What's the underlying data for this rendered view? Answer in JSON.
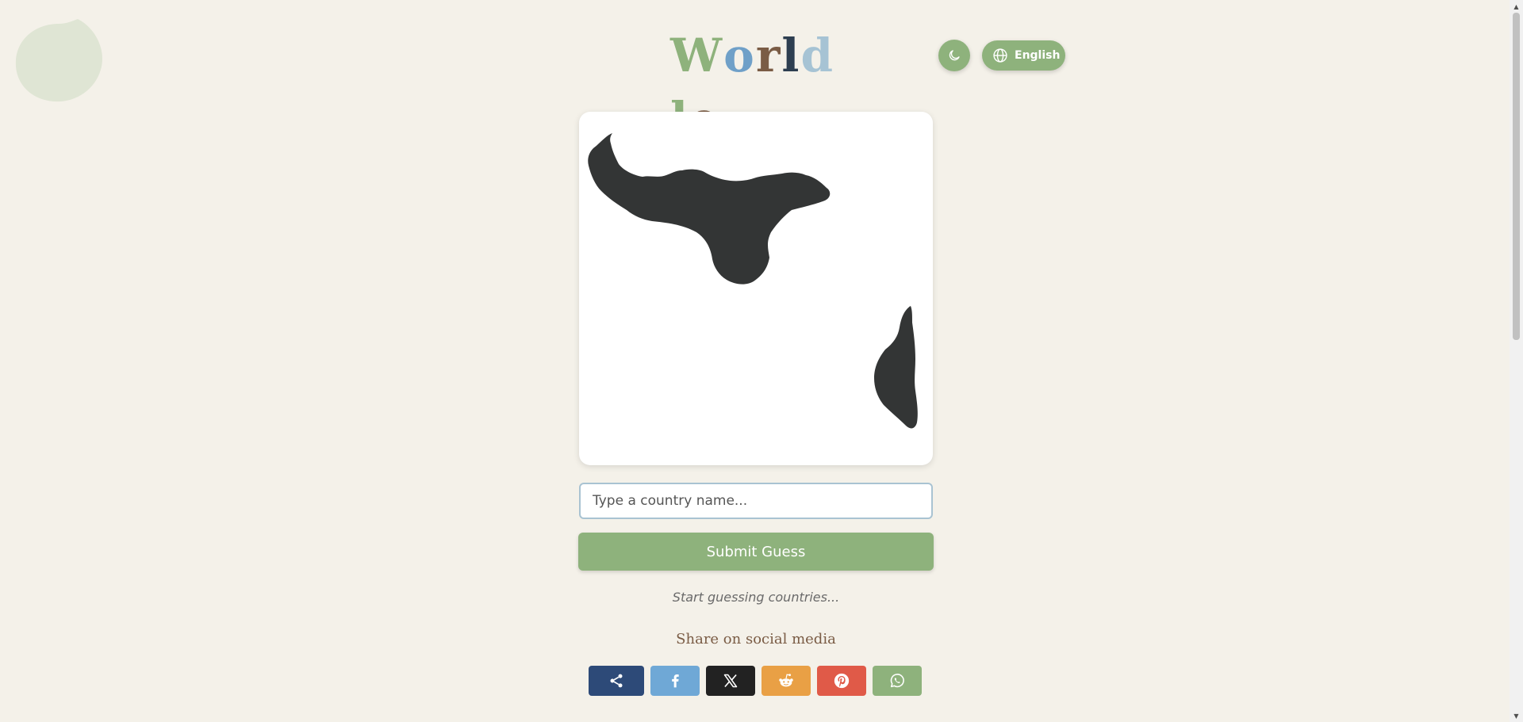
{
  "logo": {
    "letters": [
      {
        "char": "W",
        "color": "#8eb27c"
      },
      {
        "char": "o",
        "color": "#6fa0c8"
      },
      {
        "char": "r",
        "color": "#7a5c45"
      },
      {
        "char": "l",
        "color": "#2d3e50"
      },
      {
        "char": "d",
        "color": "#a6c3d4"
      },
      {
        "char": "l",
        "color": "#8eb27c"
      },
      {
        "char": "e",
        "color": "#7a5c45"
      }
    ]
  },
  "header": {
    "theme_icon": "moon-icon",
    "language_icon": "globe-icon",
    "language_label": "English"
  },
  "map": {
    "fill_color": "#333535"
  },
  "guess": {
    "placeholder": "Type a country name..."
  },
  "submit_label": "Submit Guess",
  "status_text": "Start guessing countries...",
  "share": {
    "title": "Share on social media",
    "buttons": [
      {
        "name": "share",
        "icon": "share-icon",
        "color": "#2d4a78"
      },
      {
        "name": "facebook",
        "icon": "facebook-icon",
        "color": "#6fa8d6"
      },
      {
        "name": "x",
        "icon": "x-icon",
        "color": "#222222"
      },
      {
        "name": "reddit",
        "icon": "reddit-icon",
        "color": "#e9a045"
      },
      {
        "name": "pinterest",
        "icon": "pinterest-icon",
        "color": "#e05a48"
      },
      {
        "name": "whatsapp",
        "icon": "whatsapp-icon",
        "color": "#8eb27c"
      }
    ]
  },
  "colors": {
    "background": "#f4f1e9",
    "accent": "#8eb27c",
    "blob": "#dfe5d4"
  }
}
